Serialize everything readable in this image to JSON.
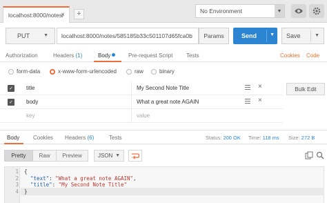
{
  "colors": {
    "accent_orange": "#f26b3a",
    "send_blue": "#2a84d2",
    "status_blue": "#2a84d2"
  },
  "tab": {
    "label": "localhost:8000/notes/",
    "close_icon": "close-icon"
  },
  "environment": {
    "selected": "No Environment"
  },
  "request": {
    "method": "PUT",
    "url": "localhost:8000/notes/585185b33c501107d65fca0b",
    "params_label": "Params",
    "send_label": "Send",
    "save_label": "Save"
  },
  "request_tabs": {
    "authorization": "Authorization",
    "headers": "Headers",
    "headers_count": "(1)",
    "body": "Body",
    "pre_request": "Pre-request Script",
    "tests": "Tests",
    "cookies": "Cookies",
    "code": "Code"
  },
  "body_types": {
    "form_data": "form-data",
    "urlencoded": "x-www-form-urlencoded",
    "raw": "raw",
    "binary": "binary",
    "selected": "x-www-form-urlencoded"
  },
  "kv_rows": [
    {
      "checked": true,
      "key": "title",
      "value": "My Second Note Title"
    },
    {
      "checked": true,
      "key": "body",
      "value": "What a great note AGAIN"
    },
    {
      "checked": false,
      "key": "key",
      "value": "value",
      "placeholder": true
    }
  ],
  "bulk_edit_label": "Bulk Edit",
  "response_tabs": {
    "body": "Body",
    "cookies": "Cookies",
    "headers": "Headers",
    "headers_count": "(6)",
    "tests": "Tests"
  },
  "response_status": {
    "status_label": "Status:",
    "status_value": "200 OK",
    "time_label": "Time:",
    "time_value": "118 ms",
    "size_label": "Size:",
    "size_value": "272 B"
  },
  "response_toolbar": {
    "pretty": "Pretty",
    "raw": "Raw",
    "preview": "Preview",
    "format": "JSON"
  },
  "response_body": {
    "lines": [
      {
        "num": "1",
        "text": "{"
      },
      {
        "num": "2",
        "key": "\"text\"",
        "value": "\"What a great note AGAIN\"",
        "trail": ","
      },
      {
        "num": "3",
        "key": "\"title\"",
        "value": "\"My Second Note Title\"",
        "trail": ""
      },
      {
        "num": "4",
        "text": "}"
      }
    ]
  }
}
